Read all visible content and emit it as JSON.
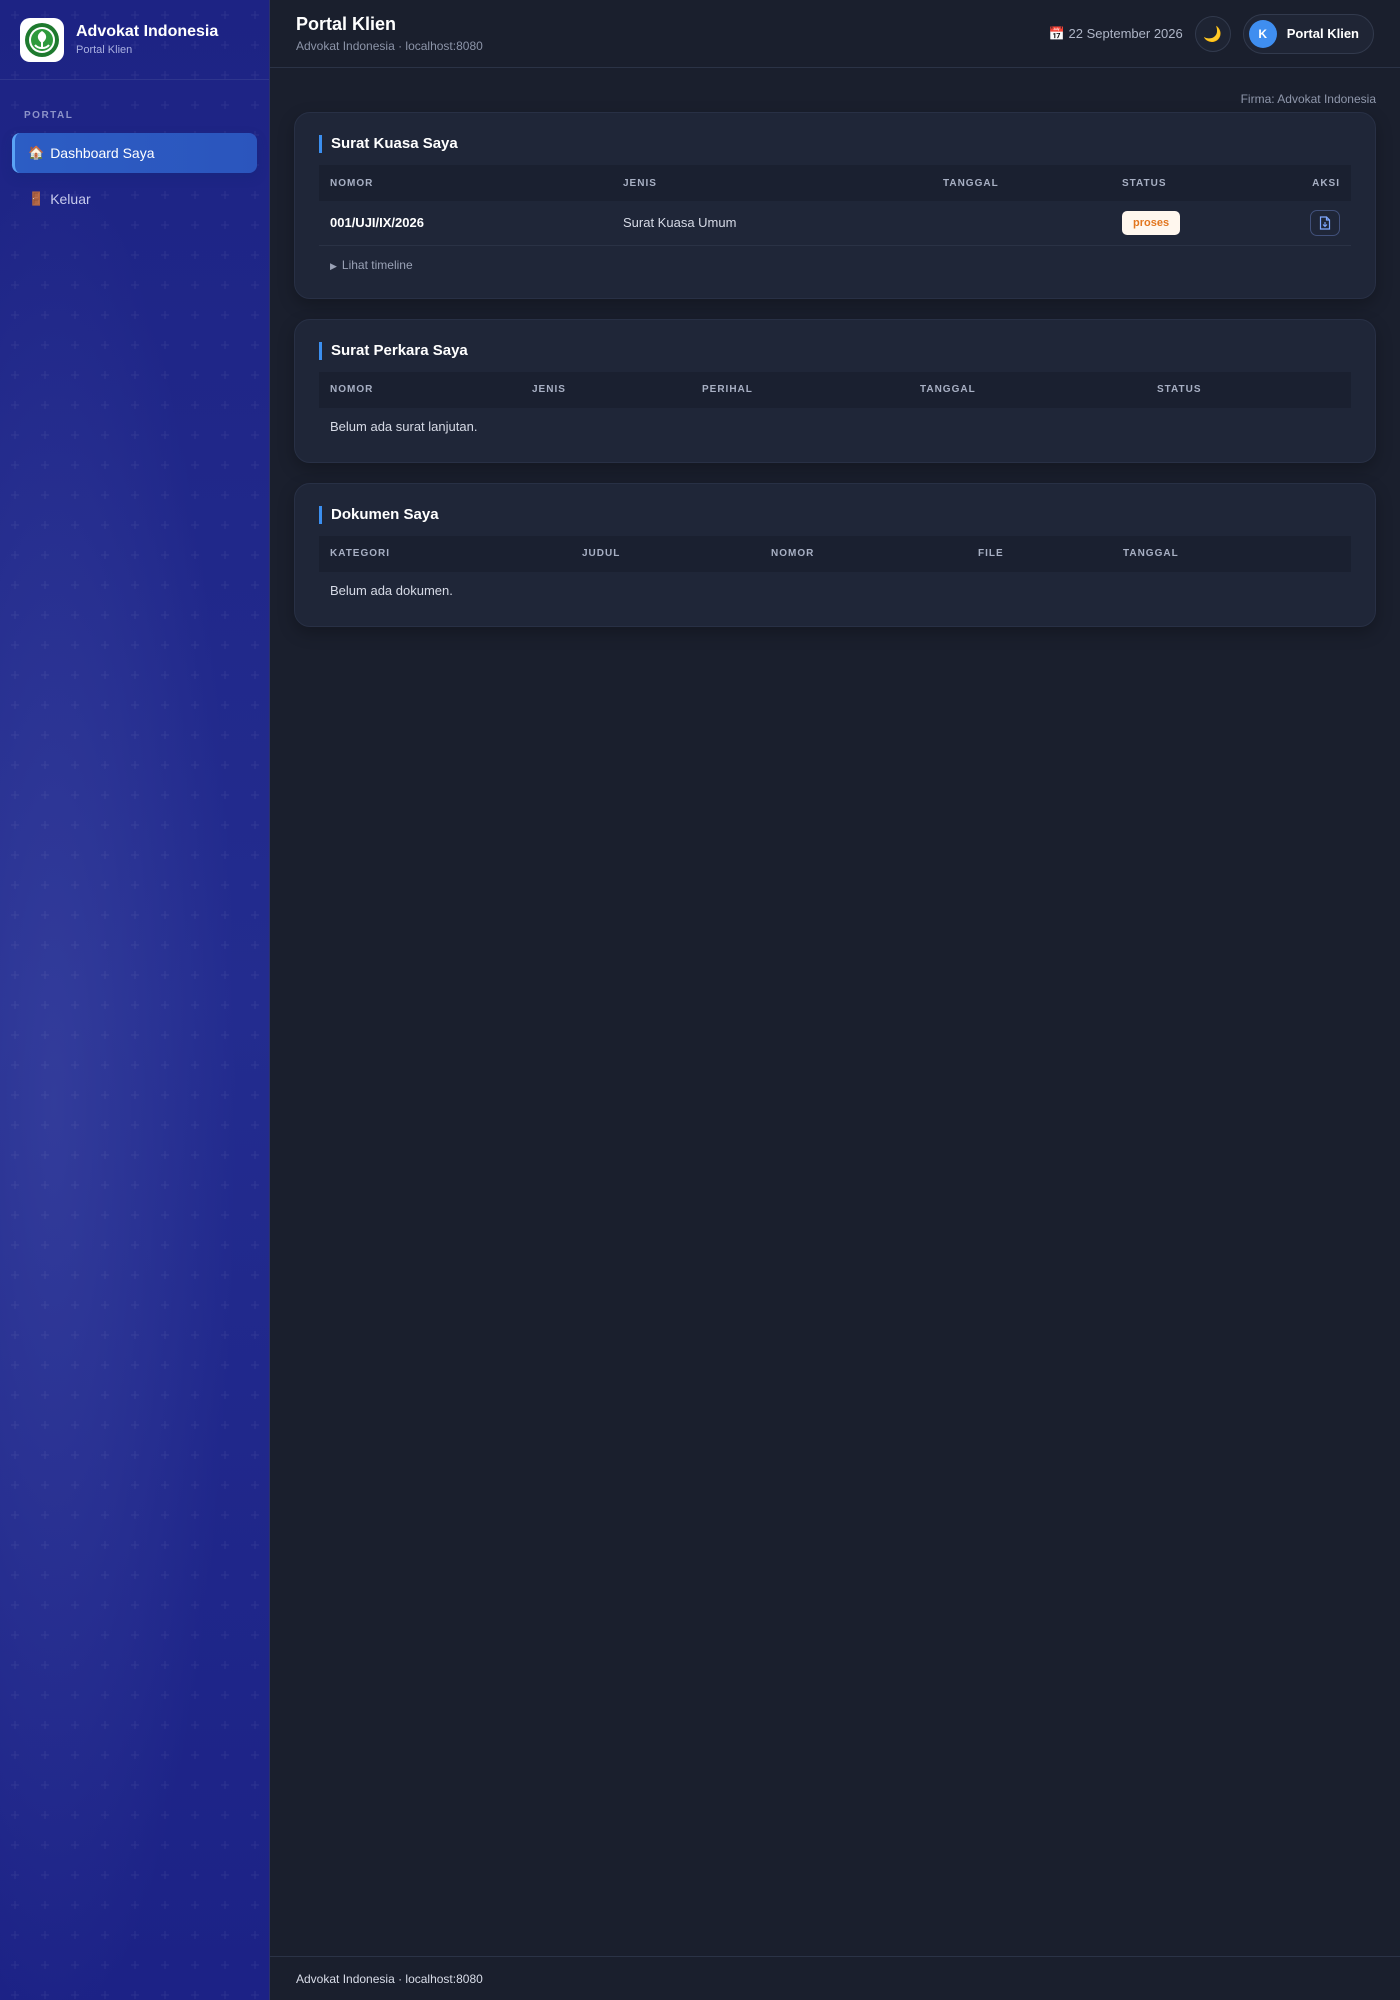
{
  "sidebar": {
    "brand_title": "Advokat Indonesia",
    "brand_subtitle": "Portal Klien",
    "section_label": "PORTAL",
    "items": [
      {
        "icon": "🏠",
        "label": "Dashboard Saya",
        "active": true
      },
      {
        "icon": "🚪",
        "label": "Keluar",
        "active": false
      }
    ]
  },
  "topbar": {
    "title": "Portal Klien",
    "subtitle": "Advokat Indonesia · localhost:8080",
    "date_icon": "📅",
    "date": "22 September 2026",
    "theme_icon": "🌙",
    "avatar_initial": "K",
    "user_label": "Portal Klien"
  },
  "firm_label": "Firma: Advokat Indonesia",
  "surat_kuasa": {
    "title": "Surat Kuasa Saya",
    "columns": [
      "NOMOR",
      "JENIS",
      "TANGGAL",
      "STATUS",
      "AKSI"
    ],
    "rows": [
      {
        "nomor": "001/UJI/IX/2026",
        "jenis": "Surat Kuasa Umum",
        "tanggal": "",
        "status": "proses"
      }
    ],
    "timeline_label": "Lihat timeline"
  },
  "surat_perkara": {
    "title": "Surat Perkara Saya",
    "columns": [
      "NOMOR",
      "JENIS",
      "PERIHAL",
      "TANGGAL",
      "STATUS"
    ],
    "empty_text": "Belum ada surat lanjutan."
  },
  "dokumen": {
    "title": "Dokumen Saya",
    "columns": [
      "KATEGORI",
      "JUDUL",
      "NOMOR",
      "FILE",
      "TANGGAL"
    ],
    "empty_text": "Belum ada dokumen."
  },
  "footer_text": "Advokat Indonesia · localhost:8080",
  "colors": {
    "sidebar_bg": "#212a88",
    "main_bg": "#1a1f2d",
    "card_bg": "#1f2638",
    "accent": "#3b8ff0",
    "badge_text": "#e2761f"
  }
}
